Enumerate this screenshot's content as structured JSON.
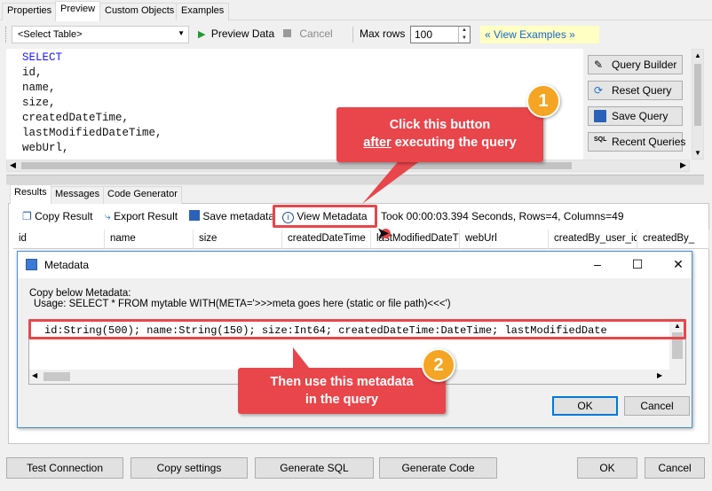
{
  "top_tabs": [
    "Properties",
    "Preview",
    "Custom Objects",
    "Examples"
  ],
  "toolbar": {
    "select_table": "<Select Table>",
    "preview_data": "Preview Data",
    "cancel": "Cancel",
    "max_rows_label": "Max rows",
    "max_rows_value": "100",
    "view_examples": "« View Examples »"
  },
  "editor": {
    "lines": [
      "SELECT",
      "id,",
      "name,",
      "size,",
      "createdDateTime,",
      "lastModifiedDateTime,",
      "webUrl,"
    ]
  },
  "side_buttons": {
    "query_builder": "Query Builder",
    "reset_query": "Reset Query",
    "save_query": "Save Query",
    "recent_queries": "Recent Queries"
  },
  "result_tabs": [
    "Results",
    "Messages",
    "Code Generator"
  ],
  "result_toolbar": {
    "copy_result": "Copy Result",
    "export_result": "Export Result",
    "save_metadata": "Save metadata",
    "view_metadata": "View Metadata",
    "status": "Took 00:00:03.394 Seconds, Rows=4, Columns=49"
  },
  "grid_columns": [
    "id",
    "name",
    "size",
    "createdDateTime",
    "lastModifiedDateTim",
    "webUrl",
    "createdBy_user_id",
    "createdBy_"
  ],
  "dialog": {
    "title": "Metadata",
    "line1": "Copy below Metadata:",
    "line2": "Usage: SELECT * FROM mytable WITH(META='>>>meta goes here (static or file path)<<<')",
    "metadata_text": "id:String(500); name:String(150); size:Int64; createdDateTime:DateTime; lastModifiedDate",
    "ok": "OK",
    "cancel": "Cancel"
  },
  "bottom_buttons": {
    "test_connection": "Test Connection",
    "copy_settings": "Copy settings",
    "generate_sql": "Generate SQL",
    "generate_code": "Generate Code",
    "ok": "OK",
    "cancel": "Cancel"
  },
  "callouts": {
    "one": {
      "number": "1",
      "line1": "Click this button",
      "line2_underlined": "after",
      "line2_rest": " executing the query"
    },
    "two": {
      "number": "2",
      "line1": "Then use this metadata",
      "line2": "in the query"
    }
  },
  "colors": {
    "callout": "#e8464b",
    "badge": "#f4a523",
    "accent": "#0078d7"
  }
}
